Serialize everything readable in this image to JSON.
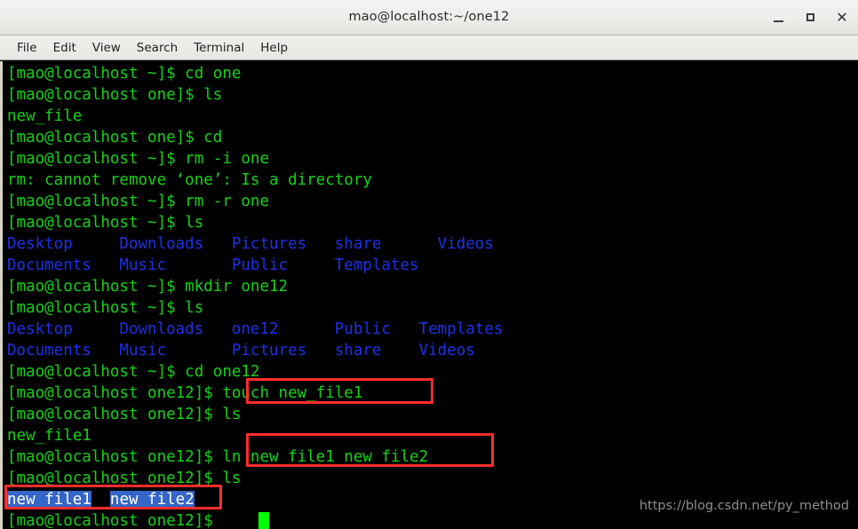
{
  "window": {
    "title": "mao@localhost:~/one12",
    "buttons": [
      {
        "name": "minimize",
        "label": "_"
      },
      {
        "name": "maximize",
        "label": "□"
      },
      {
        "name": "close",
        "label": "×"
      }
    ]
  },
  "menubar": {
    "items": [
      {
        "label": "File"
      },
      {
        "label": "Edit"
      },
      {
        "label": "View"
      },
      {
        "label": "Search"
      },
      {
        "label": "Terminal"
      },
      {
        "label": "Help"
      }
    ]
  },
  "terminal": {
    "colors": {
      "background": "#000000",
      "prompt_green": "#17d217",
      "dir_blue": "#1c32e8",
      "selection_blue": "#3465c8",
      "selection_text": "#ffffff",
      "annotation_red": "#ff2d2d",
      "cursor_green": "#00ff00"
    },
    "lines": [
      {
        "text": "[mao@localhost ~]$ cd one",
        "color": "green"
      },
      {
        "text": "[mao@localhost one]$ ls",
        "color": "green"
      },
      {
        "text": "new_file",
        "color": "green"
      },
      {
        "text": "[mao@localhost one]$ cd",
        "color": "green"
      },
      {
        "text": "[mao@localhost ~]$ rm -i one",
        "color": "green"
      },
      {
        "text": "rm: cannot remove ‘one’: Is a directory",
        "color": "green"
      },
      {
        "text": "[mao@localhost ~]$ rm -r one",
        "color": "green"
      },
      {
        "text": "[mao@localhost ~]$ ls",
        "color": "green"
      },
      {
        "text": "Desktop     Downloads   Pictures   share      Videos",
        "color": "blue"
      },
      {
        "text": "Documents   Music       Public     Templates",
        "color": "blue"
      },
      {
        "text": "[mao@localhost ~]$ mkdir one12",
        "color": "green"
      },
      {
        "text": "[mao@localhost ~]$ ls",
        "color": "green"
      },
      {
        "text": "Desktop     Downloads   one12      Public   Templates",
        "color": "blue"
      },
      {
        "text": "Documents   Music       Pictures   share    Videos",
        "color": "blue"
      },
      {
        "text": "[mao@localhost ~]$ cd one12",
        "color": "green"
      },
      {
        "text": "[mao@localhost one12]$ touch new_file1",
        "color": "green"
      },
      {
        "text": "[mao@localhost one12]$ ls",
        "color": "green"
      },
      {
        "text": "new_file1",
        "color": "green"
      },
      {
        "text": "[mao@localhost one12]$ ln new_file1 new_file2",
        "color": "green"
      },
      {
        "text": "[mao@localhost one12]$ ls",
        "color": "green"
      },
      {
        "text": "",
        "color": "green"
      },
      {
        "text": "[mao@localhost one12]$ ",
        "color": "green"
      }
    ],
    "result_line": {
      "first_file": "new_file1",
      "gap": "  ",
      "second_file": "new_file2"
    },
    "annotations": [
      {
        "name": "touch-command-highlight",
        "target": "touch new_file1"
      },
      {
        "name": "ln-command-highlight",
        "target": "ln new_file1 new_file2"
      },
      {
        "name": "ls-result-highlight",
        "target": "new_file1  new_file2"
      }
    ]
  },
  "watermark": {
    "text": "https://blog.csdn.net/py_method"
  }
}
